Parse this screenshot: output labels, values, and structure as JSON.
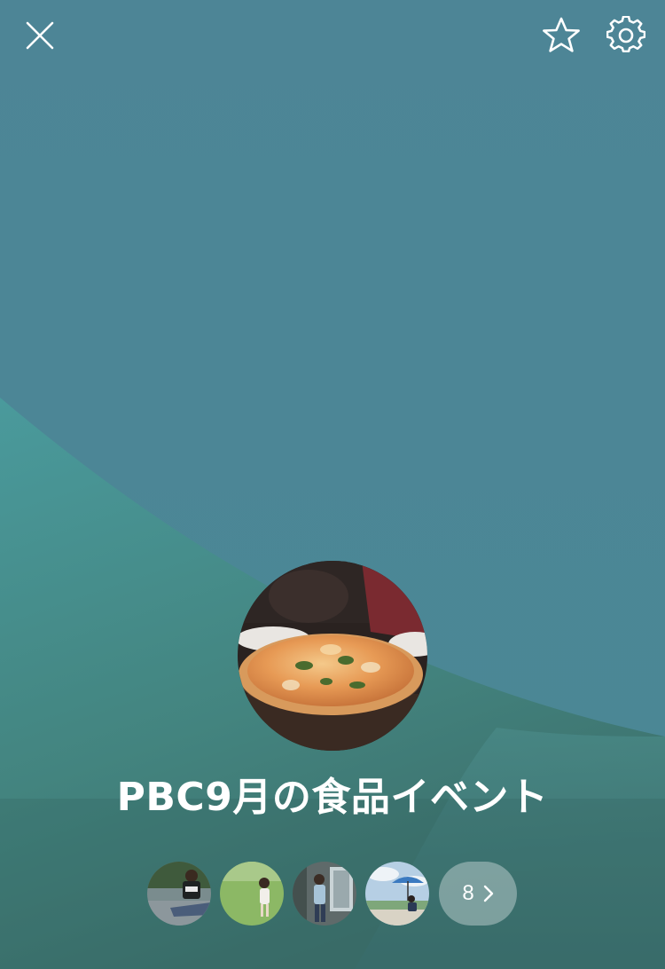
{
  "header": {
    "close_icon": "close-icon",
    "favorite_icon": "star-outline-icon",
    "settings_icon": "gear-icon"
  },
  "group": {
    "name": "PBC9月の食品イベント",
    "cover_photo": "pizza-photo"
  },
  "members": {
    "avatars": [
      "member-avatar-1",
      "member-avatar-2",
      "member-avatar-3",
      "member-avatar-4"
    ],
    "count": "8",
    "more_icon": "chevron-right-icon"
  },
  "colors": {
    "background_top": "#4b8796",
    "background_curve": "#4a9898",
    "background_bottom": "#3f7a72",
    "text": "#ffffff"
  }
}
